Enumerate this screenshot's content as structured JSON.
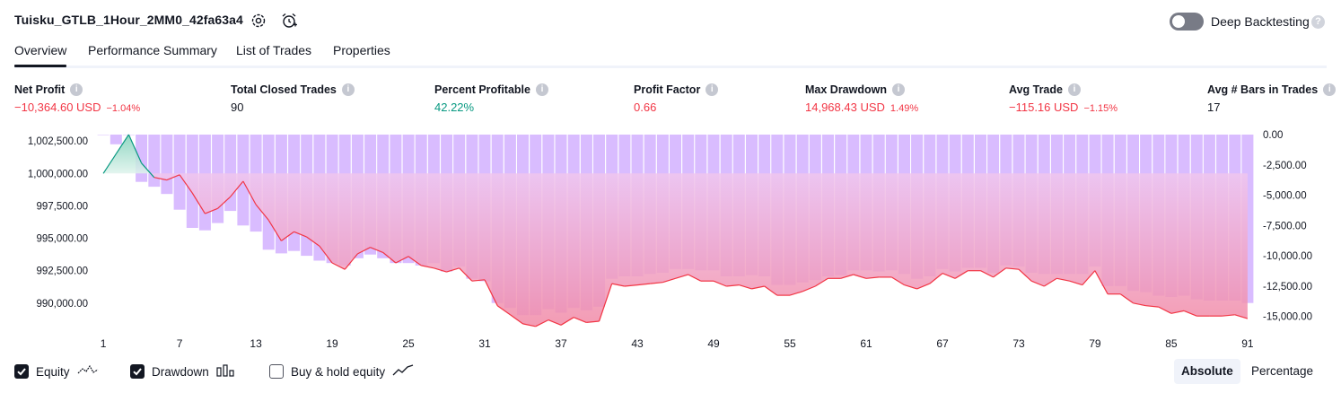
{
  "header": {
    "strategy_name": "Tuisku_GTLB_1Hour_2MM0_42fa63a4",
    "deep_backtesting_label": "Deep Backtesting",
    "help_glyph": "?"
  },
  "tabs": [
    {
      "label": "Overview",
      "active": true
    },
    {
      "label": "Performance Summary",
      "active": false
    },
    {
      "label": "List of Trades",
      "active": false
    },
    {
      "label": "Properties",
      "active": false
    }
  ],
  "metrics": [
    {
      "label": "Net Profit",
      "value": "−10,364.60 USD",
      "pct": "−1.04%",
      "tone": "neg"
    },
    {
      "label": "Total Closed Trades",
      "value": "90",
      "pct": "",
      "tone": "neutral"
    },
    {
      "label": "Percent Profitable",
      "value": "42.22%",
      "pct": "",
      "tone": "pos"
    },
    {
      "label": "Profit Factor",
      "value": "0.66",
      "pct": "",
      "tone": "neg"
    },
    {
      "label": "Max Drawdown",
      "value": "14,968.43 USD",
      "pct": "1.49%",
      "tone": "neg"
    },
    {
      "label": "Avg Trade",
      "value": "−115.16 USD",
      "pct": "−1.15%",
      "tone": "neg"
    },
    {
      "label": "Avg # Bars in Trades",
      "value": "17",
      "pct": "",
      "tone": "neutral"
    }
  ],
  "legend": {
    "equity_label": "Equity",
    "drawdown_label": "Drawdown",
    "buyhold_label": "Buy & hold equity",
    "equity_checked": true,
    "drawdown_checked": true,
    "buyhold_checked": false
  },
  "mode": {
    "absolute": "Absolute",
    "percentage": "Percentage",
    "selected": "Absolute"
  },
  "colors": {
    "loss_line": "#f23645",
    "profit_line": "#089981",
    "drawdown_bar": "#d9bcff",
    "negative_text": "#f23645",
    "positive_text": "#089981"
  },
  "chart_data": {
    "type": "area",
    "x_ticks": [
      1,
      7,
      13,
      19,
      25,
      31,
      37,
      43,
      49,
      55,
      61,
      67,
      73,
      79,
      85,
      91
    ],
    "left_axis_ticks": [
      "1,002,500.00",
      "1,000,000.00",
      "997,500.00",
      "995,000.00",
      "992,500.00",
      "990,000.00"
    ],
    "left_axis_values": [
      1002500,
      1000000,
      997500,
      995000,
      992500,
      990000
    ],
    "right_axis_ticks": [
      "0.00",
      "-2,500.00",
      "-5,000.00",
      "-7,500.00",
      "-10,000.00",
      "-12,500.00",
      "-15,000.00"
    ],
    "right_axis_values": [
      0,
      -2500,
      -5000,
      -7500,
      -10000,
      -12500,
      -15000
    ],
    "equity_range": [
      988600,
      1003000
    ],
    "drawdown_range": [
      -15400,
      0
    ],
    "series": [
      {
        "name": "Equity",
        "x": [
          1,
          2,
          3,
          4,
          5,
          6,
          7,
          8,
          9,
          10,
          11,
          12,
          13,
          14,
          15,
          16,
          17,
          18,
          19,
          20,
          21,
          22,
          23,
          24,
          25,
          26,
          27,
          28,
          28,
          30,
          31,
          32,
          33,
          34,
          35,
          36,
          37,
          38,
          39,
          40,
          41,
          42,
          43,
          44,
          45,
          46,
          47,
          48,
          49,
          50,
          51,
          52,
          53,
          54,
          55,
          56,
          57,
          58,
          59,
          60,
          61,
          62,
          63,
          64,
          65,
          66,
          67,
          68,
          69,
          70,
          71,
          72,
          73,
          74,
          75,
          76,
          77,
          78,
          79,
          80,
          81,
          82,
          83,
          84,
          85,
          86,
          87,
          88,
          89,
          90,
          91
        ],
        "values": [
          1000000,
          1001500,
          1003000,
          1000800,
          999700,
          999500,
          999900,
          998500,
          996900,
          997300,
          998200,
          999400,
          997600,
          996400,
          994800,
          995500,
          995100,
          994400,
          993100,
          992600,
          993800,
          994300,
          993900,
          993100,
          993600,
          992900,
          992700,
          992400,
          992700,
          991700,
          991800,
          989800,
          989100,
          988400,
          988200,
          988700,
          988300,
          988900,
          988500,
          988600,
          991500,
          991300,
          991400,
          991500,
          991600,
          991900,
          992200,
          991700,
          991700,
          991300,
          991400,
          991100,
          991300,
          990600,
          990600,
          990900,
          991300,
          991900,
          991900,
          992200,
          991900,
          992000,
          992000,
          991400,
          991100,
          991500,
          992300,
          991900,
          992500,
          992500,
          992000,
          992700,
          992600,
          991700,
          991300,
          991900,
          991700,
          991400,
          992500,
          990700,
          990700,
          990000,
          989800,
          989700,
          989200,
          989400,
          989000,
          989000,
          989000,
          989100,
          988800
        ]
      },
      {
        "name": "Drawdown",
        "x": [
          1,
          2,
          3,
          4,
          5,
          6,
          7,
          8,
          9,
          10,
          11,
          12,
          13,
          14,
          15,
          16,
          17,
          18,
          19,
          20,
          21,
          22,
          23,
          24,
          25,
          26,
          27,
          28,
          29,
          30,
          31,
          32,
          33,
          34,
          35,
          36,
          37,
          38,
          39,
          40,
          41,
          42,
          43,
          44,
          45,
          46,
          47,
          48,
          49,
          50,
          51,
          52,
          53,
          54,
          55,
          56,
          57,
          58,
          59,
          60,
          61,
          62,
          63,
          64,
          65,
          66,
          67,
          68,
          69,
          70,
          71,
          72,
          73,
          74,
          75,
          76,
          77,
          78,
          79,
          80,
          81,
          82,
          83,
          84,
          85,
          86,
          87,
          88,
          89,
          90,
          91
        ],
        "values": [
          0,
          -800,
          0,
          -3900,
          -4300,
          -4900,
          -6200,
          -7700,
          -7900,
          -7300,
          -6300,
          -7500,
          -8000,
          -9500,
          -9800,
          -9600,
          -10000,
          -10400,
          -10600,
          -10800,
          -10200,
          -9900,
          -10200,
          -10600,
          -10600,
          -10800,
          -10600,
          -11300,
          -10900,
          -11900,
          -12100,
          -13900,
          -14300,
          -14900,
          -14900,
          -14400,
          -14700,
          -14300,
          -14500,
          -14200,
          -11900,
          -11700,
          -11700,
          -11500,
          -11400,
          -11100,
          -11100,
          -11200,
          -11200,
          -11700,
          -11700,
          -11600,
          -11700,
          -12400,
          -12400,
          -12200,
          -12000,
          -11700,
          -11600,
          -11200,
          -11200,
          -11300,
          -11200,
          -11500,
          -11900,
          -11700,
          -11100,
          -11300,
          -11000,
          -11000,
          -11400,
          -10800,
          -10900,
          -11400,
          -11500,
          -11500,
          -11500,
          -11500,
          -10900,
          -12500,
          -12500,
          -12900,
          -13000,
          -13300,
          -13400,
          -13300,
          -13600,
          -13700,
          -13700,
          -13700,
          -13900
        ]
      }
    ]
  }
}
